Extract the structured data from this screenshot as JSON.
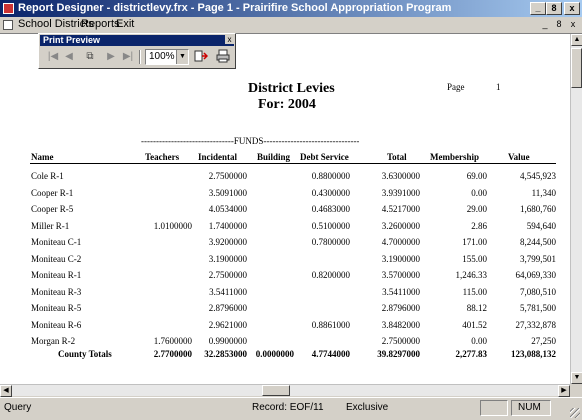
{
  "window": {
    "title": "Report Designer - districtlevy.frx - Page 1 - Prairifire School Appropriation Program",
    "min": "_",
    "max": "8",
    "close": "x"
  },
  "menu": {
    "items": [
      "School Districts",
      "Reports",
      "Exit"
    ],
    "mdi_min": "_",
    "mdi_max": "8",
    "mdi_close": "x"
  },
  "print_preview": {
    "title": "Print Preview",
    "close": "x",
    "zoom": "100%"
  },
  "report": {
    "title": "District Levies",
    "subtitle": "For:  2004",
    "page_label": "Page",
    "page_number": "1",
    "funds_label": "-------------------------------FUNDS-----------------------------------",
    "columns": [
      "Name",
      "Teachers",
      "Incidental",
      "Building",
      "Debt Service",
      "Total",
      "Membership",
      "Value"
    ],
    "rows": [
      {
        "name": "Cole R-1",
        "teachers": "",
        "incidental": "2.7500000",
        "building": "",
        "debt": "0.8800000",
        "total": "3.6300000",
        "membership": "69.00",
        "value": "4,545,923"
      },
      {
        "name": "Cooper R-1",
        "teachers": "",
        "incidental": "3.5091000",
        "building": "",
        "debt": "0.4300000",
        "total": "3.9391000",
        "membership": "0.00",
        "value": "11,340"
      },
      {
        "name": "Cooper R-5",
        "teachers": "",
        "incidental": "4.0534000",
        "building": "",
        "debt": "0.4683000",
        "total": "4.5217000",
        "membership": "29.00",
        "value": "1,680,760"
      },
      {
        "name": "Miller R-1",
        "teachers": "1.0100000",
        "incidental": "1.7400000",
        "building": "",
        "debt": "0.5100000",
        "total": "3.2600000",
        "membership": "2.86",
        "value": "594,640"
      },
      {
        "name": "Moniteau C-1",
        "teachers": "",
        "incidental": "3.9200000",
        "building": "",
        "debt": "0.7800000",
        "total": "4.7000000",
        "membership": "171.00",
        "value": "8,244,500"
      },
      {
        "name": "Moniteau C-2",
        "teachers": "",
        "incidental": "3.1900000",
        "building": "",
        "debt": "",
        "total": "3.1900000",
        "membership": "155.00",
        "value": "3,799,501"
      },
      {
        "name": "Moniteau R-1",
        "teachers": "",
        "incidental": "2.7500000",
        "building": "",
        "debt": "0.8200000",
        "total": "3.5700000",
        "membership": "1,246.33",
        "value": "64,069,330"
      },
      {
        "name": "Moniteau R-3",
        "teachers": "",
        "incidental": "3.5411000",
        "building": "",
        "debt": "",
        "total": "3.5411000",
        "membership": "115.00",
        "value": "7,080,510"
      },
      {
        "name": "Moniteau R-5",
        "teachers": "",
        "incidental": "2.8796000",
        "building": "",
        "debt": "",
        "total": "2.8796000",
        "membership": "88.12",
        "value": "5,781,500"
      },
      {
        "name": "Moniteau R-6",
        "teachers": "",
        "incidental": "2.9621000",
        "building": "",
        "debt": "0.8861000",
        "total": "3.8482000",
        "membership": "401.52",
        "value": "27,332,878"
      },
      {
        "name": "Morgan R-2",
        "teachers": "1.7600000",
        "incidental": "0.9900000",
        "building": "",
        "debt": "",
        "total": "2.7500000",
        "membership": "0.00",
        "value": "27,250"
      }
    ],
    "totals": {
      "name": "County Totals",
      "teachers": "2.7700000",
      "incidental": "32.2853000",
      "building": "0.0000000",
      "debt": "4.7744000",
      "total": "39.8297000",
      "membership": "2,277.83",
      "value": "123,088,132"
    }
  },
  "status": {
    "left": "Query",
    "record": "Record: EOF/11",
    "mode": "Exclusive",
    "num": "NUM"
  }
}
